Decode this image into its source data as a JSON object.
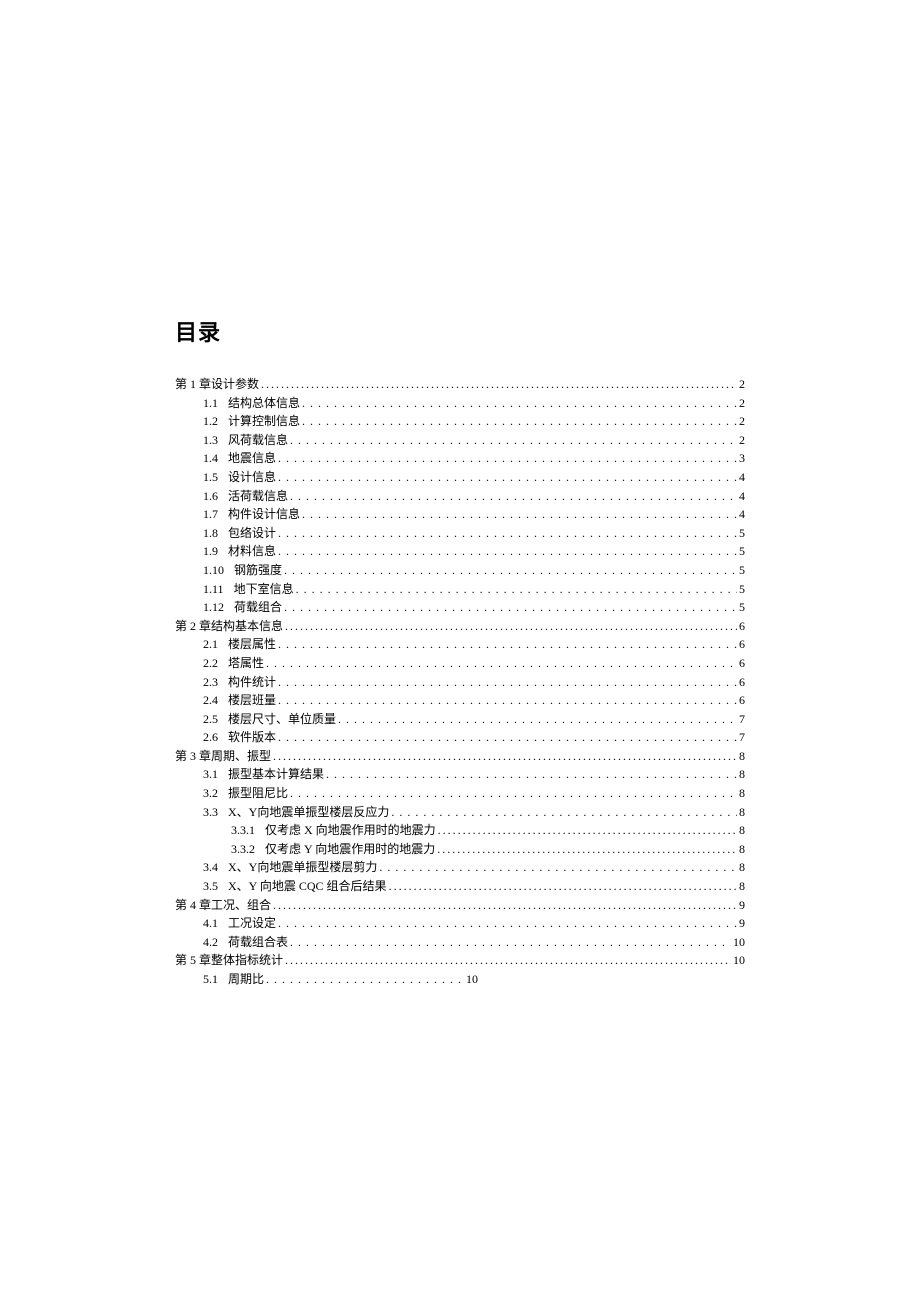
{
  "title": "目录",
  "toc": [
    {
      "level": 0,
      "num": "第 1 章",
      "label": "设计参数",
      "page": "2",
      "tight": true
    },
    {
      "level": 1,
      "num": "1.1",
      "label": "结构总体信息",
      "page": "2"
    },
    {
      "level": 1,
      "num": "1.2",
      "label": "计算控制信息",
      "page": "2"
    },
    {
      "level": 1,
      "num": "1.3",
      "label": "风荷载信息",
      "page": "2"
    },
    {
      "level": 1,
      "num": "1.4",
      "label": "地震信息",
      "page": "3"
    },
    {
      "level": 1,
      "num": "1.5",
      "label": "设计信息",
      "page": "4"
    },
    {
      "level": 1,
      "num": "1.6",
      "label": "活荷载信息",
      "page": "4"
    },
    {
      "level": 1,
      "num": "1.7",
      "label": "构件设计信息",
      "page": "4"
    },
    {
      "level": 1,
      "num": "1.8",
      "label": "包络设计",
      "page": "5"
    },
    {
      "level": 1,
      "num": "1.9",
      "label": "材料信息",
      "page": "5"
    },
    {
      "level": 1,
      "num": "1.10",
      "label": "钢筋强度",
      "page": "5"
    },
    {
      "level": 1,
      "num": "1.11",
      "label": "地下室信息",
      "page": "5"
    },
    {
      "level": 1,
      "num": "1.12",
      "label": "荷载组合",
      "page": "5"
    },
    {
      "level": 0,
      "num": "第 2 章",
      "label": "结构基本信息",
      "page": "6",
      "tight": true
    },
    {
      "level": 1,
      "num": "2.1",
      "label": "楼层属性",
      "page": "6"
    },
    {
      "level": 1,
      "num": "2.2",
      "label": "塔属性",
      "page": "6"
    },
    {
      "level": 1,
      "num": "2.3",
      "label": "构件统计",
      "page": "6"
    },
    {
      "level": 1,
      "num": "2.4",
      "label": "楼层班量",
      "page": "6"
    },
    {
      "level": 1,
      "num": "2.5",
      "label": "楼层尺寸、单位质量",
      "page": "7"
    },
    {
      "level": 1,
      "num": "2.6",
      "label": "软件版本",
      "page": "7"
    },
    {
      "level": 0,
      "num": "第 3 章",
      "label": "周期、振型",
      "page": "8",
      "tight": true
    },
    {
      "level": 1,
      "num": "3.1",
      "label": "振型基本计算结果",
      "page": "8"
    },
    {
      "level": 1,
      "num": "3.2",
      "label": "振型阻尼比",
      "page": "8"
    },
    {
      "level": 1,
      "num": "3.3",
      "label": "X、Y向地震单振型楼层反应力",
      "page": "8"
    },
    {
      "level": 2,
      "num": "3.3.1",
      "label": "仅考虑 X 向地震作用时的地震力",
      "page": "8",
      "tight": true
    },
    {
      "level": 2,
      "num": "3.3.2",
      "label": "仅考虑 Y 向地震作用时的地震力",
      "page": "8",
      "tight": true
    },
    {
      "level": 1,
      "num": "3.4",
      "label": "X、Y向地震单振型楼层剪力",
      "page": "8"
    },
    {
      "level": 1,
      "num": "3.5",
      "label": "X、Y 向地震 CQC 组合后结果",
      "page": "8",
      "tight": true
    },
    {
      "level": 0,
      "num": "第 4 章",
      "label": "工况、组合",
      "page": "9",
      "tight": true
    },
    {
      "level": 1,
      "num": "4.1",
      "label": "工况设定",
      "page": "9"
    },
    {
      "level": 1,
      "num": "4.2",
      "label": "荷载组合表",
      "page": "10"
    },
    {
      "level": 0,
      "num": "第 5 章",
      "label": "整体指标统计",
      "page": "10",
      "tight": true
    }
  ],
  "last": {
    "num": "5.1",
    "label": "周期比",
    "page": "10"
  }
}
